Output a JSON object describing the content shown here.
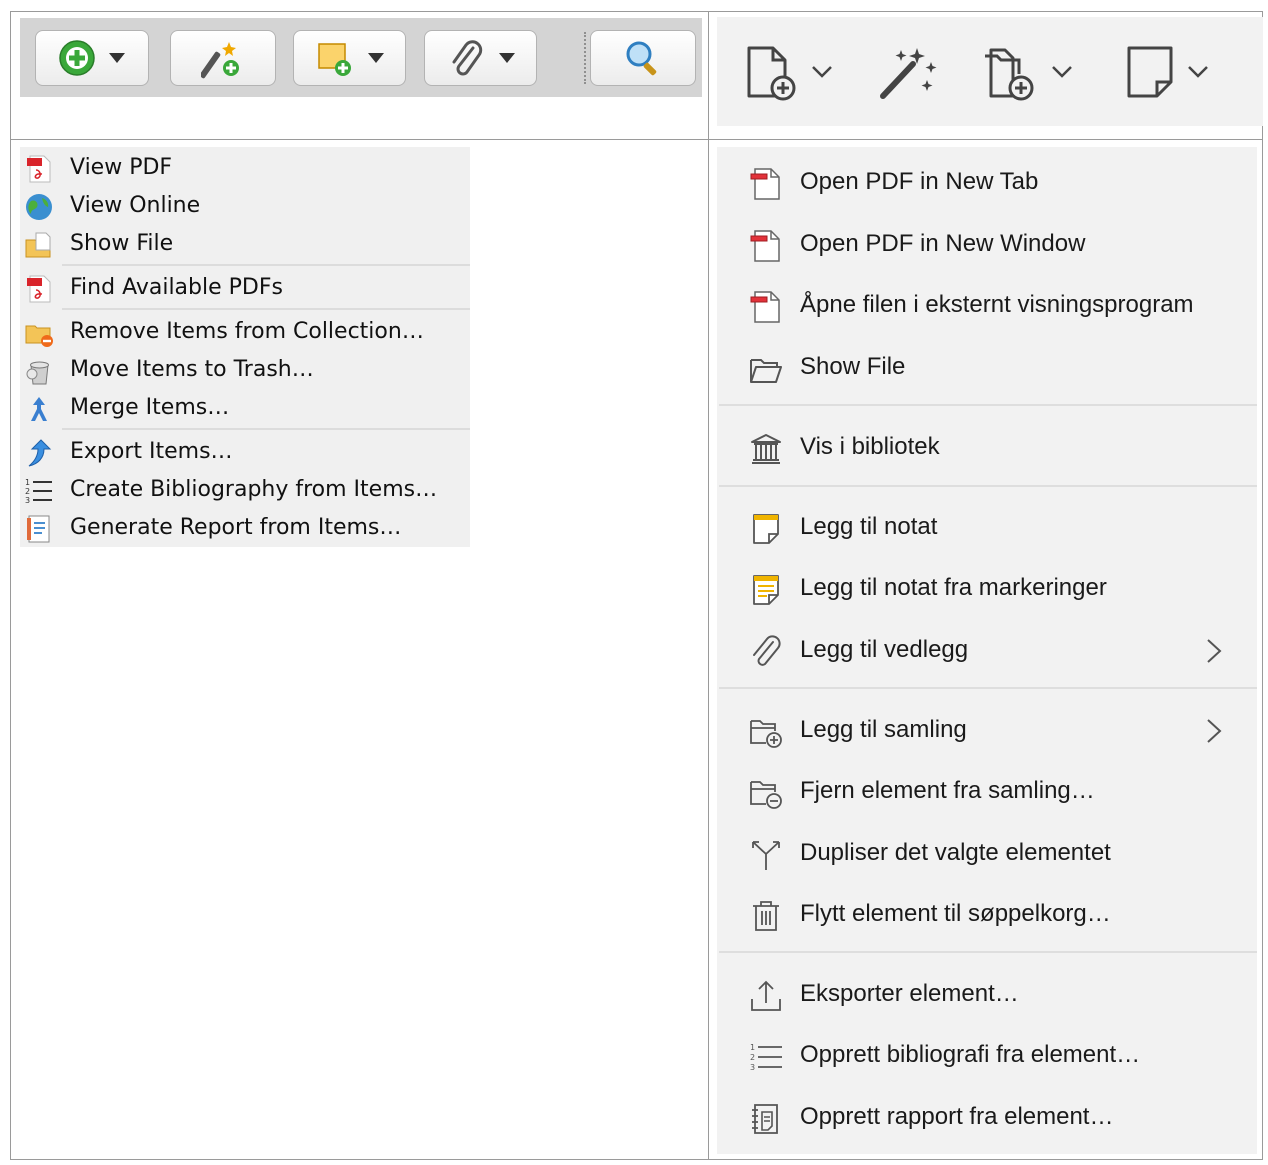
{
  "old_toolbar": {
    "buttons": [
      {
        "icon": "add-circle-icon",
        "dropdown": true
      },
      {
        "icon": "magic-wand-icon",
        "dropdown": false
      },
      {
        "icon": "new-note-icon",
        "dropdown": true
      },
      {
        "icon": "paperclip-icon",
        "dropdown": true
      },
      {
        "icon": "search-icon",
        "dropdown": false
      }
    ]
  },
  "old_menu": {
    "items": [
      {
        "label": "View PDF",
        "icon": "pdf-icon"
      },
      {
        "label": "View Online",
        "icon": "globe-icon"
      },
      {
        "label": "Show File",
        "icon": "folder-file-icon"
      },
      {
        "label": "Find Available PDFs",
        "icon": "pdf-icon"
      },
      {
        "label": "Remove Items from Collection…",
        "icon": "folder-remove-icon"
      },
      {
        "label": "Move Items to Trash…",
        "icon": "trash-icon"
      },
      {
        "label": "Merge Items…",
        "icon": "merge-icon"
      },
      {
        "label": "Export Items…",
        "icon": "export-arrow-icon"
      },
      {
        "label": "Create Bibliography from Items…",
        "icon": "numbered-list-icon"
      },
      {
        "label": "Generate Report from Items…",
        "icon": "report-icon"
      }
    ]
  },
  "new_toolbar": {
    "buttons": [
      {
        "icon": "new-document-icon",
        "dropdown": true
      },
      {
        "icon": "magic-wand-icon",
        "dropdown": false
      },
      {
        "icon": "add-to-collection-icon",
        "dropdown": true
      },
      {
        "icon": "note-icon",
        "dropdown": true
      }
    ]
  },
  "new_menu": {
    "items": [
      {
        "label": "Open PDF in New Tab",
        "icon": "pdf-icon",
        "submenu": false
      },
      {
        "label": "Open PDF in New Window",
        "icon": "pdf-icon",
        "submenu": false
      },
      {
        "label": "Åpne filen i eksternt visningsprogram",
        "icon": "pdf-icon",
        "submenu": false
      },
      {
        "label": "Show File",
        "icon": "folder-icon",
        "submenu": false
      },
      {
        "label": "Vis i bibliotek",
        "icon": "library-icon",
        "submenu": false
      },
      {
        "label": "Legg til notat",
        "icon": "note-icon",
        "submenu": false
      },
      {
        "label": "Legg til notat fra markeringer",
        "icon": "note-from-annotations-icon",
        "submenu": false
      },
      {
        "label": "Legg til vedlegg",
        "icon": "paperclip-icon",
        "submenu": true
      },
      {
        "label": "Legg til samling",
        "icon": "add-to-collection-icon",
        "submenu": true
      },
      {
        "label": "Fjern element fra samling…",
        "icon": "remove-from-collection-icon",
        "submenu": false
      },
      {
        "label": "Dupliser det valgte elementet",
        "icon": "duplicate-icon",
        "submenu": false
      },
      {
        "label": "Flytt element til søppelkorg…",
        "icon": "trash-icon",
        "submenu": false
      },
      {
        "label": "Eksporter element…",
        "icon": "export-icon",
        "submenu": false
      },
      {
        "label": "Opprett bibliografi fra element…",
        "icon": "numbered-list-icon",
        "submenu": false
      },
      {
        "label": "Opprett rapport fra element…",
        "icon": "report-icon",
        "submenu": false
      }
    ]
  },
  "colors": {
    "old_toolbar_bg": "#d4d4d4",
    "old_menu_bg": "#f0f0f0",
    "new_panel_bg": "#f2f2f2",
    "green_add": "#3aa83a",
    "pdf_red": "#d9242b",
    "note_yellow": "#f0b400",
    "border": "#9a9a9a"
  }
}
